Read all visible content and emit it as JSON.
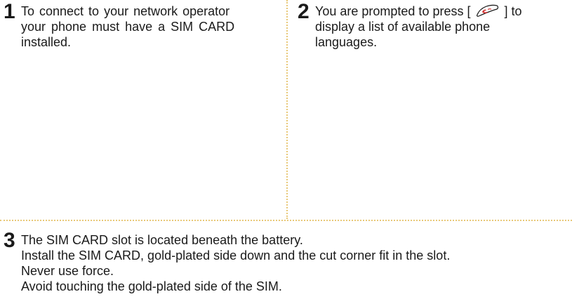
{
  "steps": [
    {
      "number": "1",
      "lines": [
        "To connect to your network operator",
        "your phone must have a SIM CARD",
        "installed."
      ]
    },
    {
      "number": "2",
      "line1_before_icon": "You are prompted to press [",
      "line1_after_icon": "] to",
      "icon": "send-call-key-icon",
      "lines_rest": [
        "display a list of available phone",
        "languages."
      ]
    },
    {
      "number": "3",
      "lines": [
        "The SIM CARD slot is located beneath the battery.",
        "Install the SIM CARD, gold-plated side down and the cut corner fit in the slot.",
        "Never use force.",
        "Avoid touching the gold-plated side of the SIM."
      ]
    }
  ],
  "colors": {
    "divider": "#e8c878",
    "icon_red": "#d33a3a"
  }
}
